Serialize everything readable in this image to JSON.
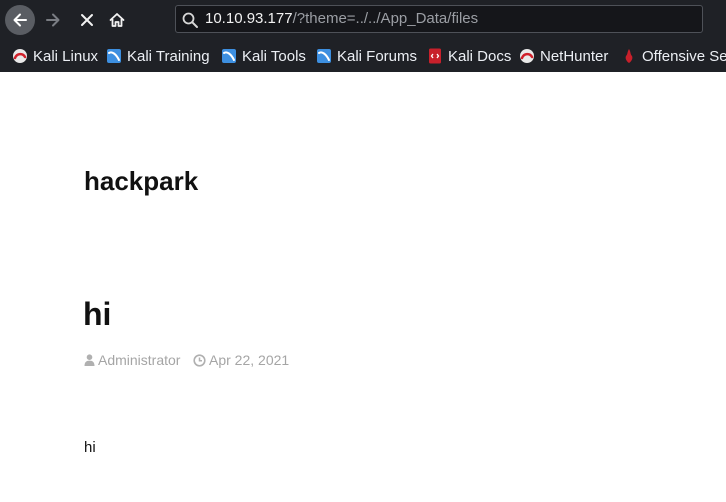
{
  "browser": {
    "url_host": "10.10.93.177",
    "url_path": "/?theme=../../App_Data/files",
    "bookmarks": [
      {
        "label": "Kali Linux",
        "icon": "kali-dragon-icon"
      },
      {
        "label": "Kali Training",
        "icon": "kali-training-icon"
      },
      {
        "label": "Kali Tools",
        "icon": "kali-tools-icon"
      },
      {
        "label": "Kali Forums",
        "icon": "kali-forums-icon"
      },
      {
        "label": "Kali Docs",
        "icon": "kali-docs-icon"
      },
      {
        "label": "NetHunter",
        "icon": "nethunter-icon"
      },
      {
        "label": "Offensive Sec",
        "icon": "offensive-security-icon"
      }
    ]
  },
  "page": {
    "site_title": "hackpark",
    "post": {
      "title": "hi",
      "author": "Administrator",
      "date": "Apr 22, 2021",
      "body": "hi"
    }
  },
  "colors": {
    "chrome_bg": "#1f2126",
    "urlbar_bg": "#15161a",
    "meta_gray": "#a5a5a5"
  }
}
